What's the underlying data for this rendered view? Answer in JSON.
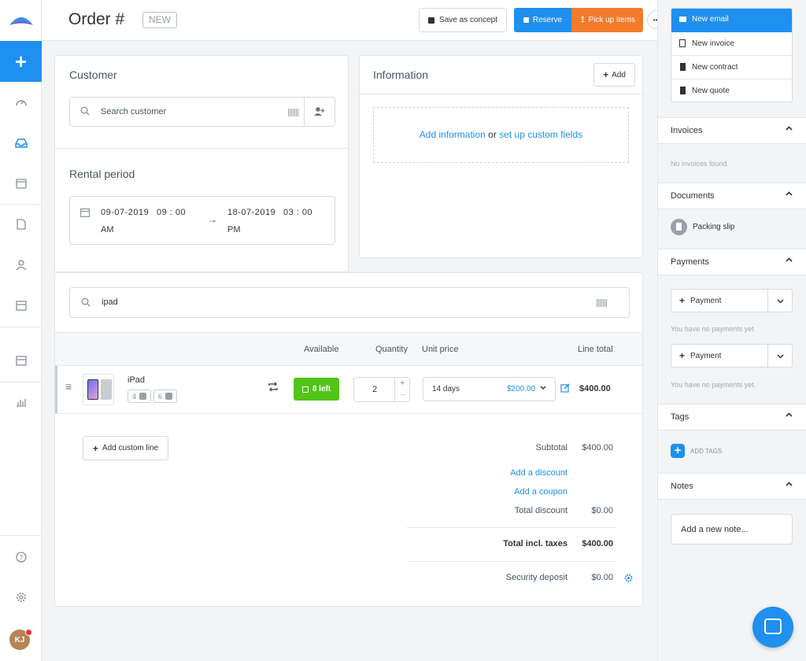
{
  "header": {
    "title": "Order #",
    "status_badge": "NEW",
    "save_concept": "Save as concept",
    "reserve": "Reserve",
    "pickup": "Pick up items",
    "more": "•••"
  },
  "customer": {
    "heading": "Customer",
    "search_placeholder": "Search customer"
  },
  "rental_period": {
    "heading": "Rental period",
    "start_date": "09-07-2019",
    "start_time": "09 : 00",
    "start_ampm": "AM",
    "end_date": "18-07-2019",
    "end_time": "03 : 00",
    "end_ampm": "PM"
  },
  "information": {
    "heading": "Information",
    "add_button": "Add",
    "add_info_link": "Add information",
    "or_text": "or",
    "custom_fields_link": "set up custom fields"
  },
  "products": {
    "search_value": "ipad",
    "columns": {
      "available": "Available",
      "quantity": "Quantity",
      "unit_price": "Unit price",
      "line_total": "Line total"
    },
    "line": {
      "name": "iPad",
      "chip_1": "4",
      "chip_2": "6",
      "available": "8 left",
      "quantity": "2",
      "period": "14 days",
      "price": "$200.00",
      "line_total": "$400.00"
    },
    "add_custom_line": "Add custom line"
  },
  "totals": {
    "subtotal_label": "Subtotal",
    "subtotal_value": "$400.00",
    "add_discount": "Add a discount",
    "add_coupon": "Add a coupon",
    "total_discount_label": "Total discount",
    "total_discount_value": "$0.00",
    "total_incl_label": "Total incl. taxes",
    "total_incl_value": "$400.00",
    "deposit_label": "Security deposit",
    "deposit_value": "$0.00"
  },
  "right_panel": {
    "actions": [
      "New email",
      "New invoice",
      "New contract",
      "New quote"
    ],
    "invoices": {
      "title": "Invoices",
      "empty": "No invoices found."
    },
    "documents": {
      "title": "Documents",
      "item": "Packing slip"
    },
    "payments": {
      "title": "Payments",
      "button": "Payment",
      "empty_1": "You have no payments yet",
      "empty_2": "You have no payments yet."
    },
    "tags": {
      "title": "Tags",
      "add": "ADD TAGS"
    },
    "notes": {
      "title": "Notes",
      "placeholder": "Add a new note..."
    }
  },
  "user": {
    "initials": "KJ"
  },
  "colors": {
    "accent": "#1f8ff0",
    "orange": "#f47b2c",
    "green": "#52c41a"
  }
}
